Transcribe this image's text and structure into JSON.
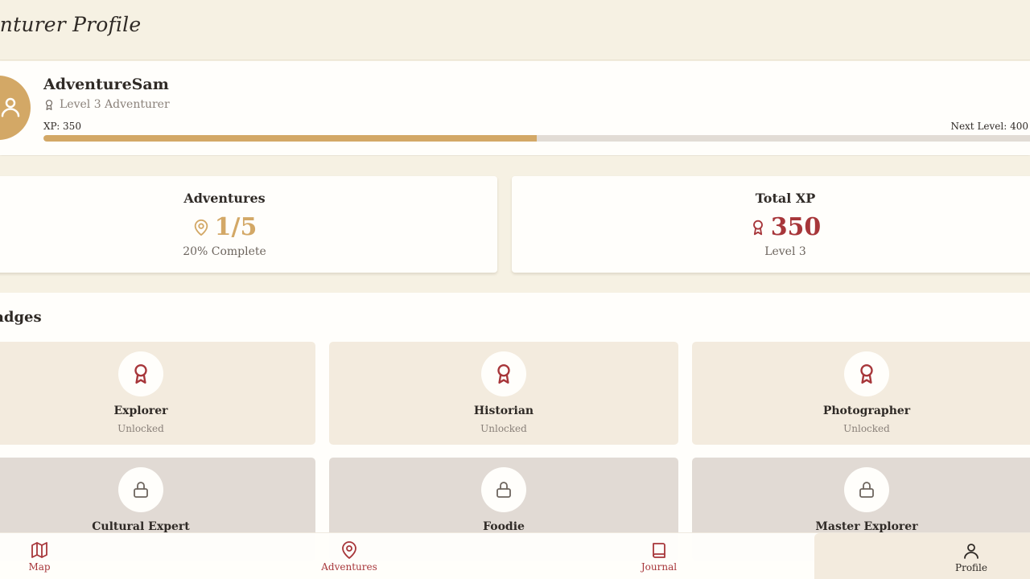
{
  "header": {
    "title": "Adventurer Profile"
  },
  "profile": {
    "username": "AdventureSam",
    "level_text": "Level 3 Adventurer",
    "xp_label": "XP: 350",
    "next_level_label": "Next Level: 400",
    "xp_progress_fraction": 0.5,
    "avatar_icon": "user-icon"
  },
  "stats": {
    "adventures": {
      "title": "Adventures",
      "value": "1/5",
      "subtitle": "20% Complete",
      "icon": "map-pin-icon"
    },
    "total_xp": {
      "title": "Total XP",
      "value": "350",
      "subtitle": "Level 3",
      "icon": "award-icon"
    }
  },
  "badges": {
    "heading": "Badges",
    "items": [
      {
        "name": "Explorer",
        "status": "Unlocked",
        "locked": false,
        "icon": "award-icon"
      },
      {
        "name": "Historian",
        "status": "Unlocked",
        "locked": false,
        "icon": "award-icon"
      },
      {
        "name": "Photographer",
        "status": "Unlocked",
        "locked": false,
        "icon": "award-icon"
      },
      {
        "name": "Cultural Expert",
        "status": "",
        "locked": true,
        "icon": "lock-icon"
      },
      {
        "name": "Foodie",
        "status": "",
        "locked": true,
        "icon": "lock-icon"
      },
      {
        "name": "Master Explorer",
        "status": "",
        "locked": true,
        "icon": "lock-icon"
      }
    ]
  },
  "nav": {
    "items": [
      {
        "label": "Map",
        "icon": "map-icon"
      },
      {
        "label": "Adventures",
        "icon": "map-pin-icon"
      },
      {
        "label": "Journal",
        "icon": "book-icon"
      },
      {
        "label": "Profile",
        "icon": "user-icon",
        "active": true
      }
    ]
  },
  "colors": {
    "accent_gold": "#d3a866",
    "accent_red": "#a7363a",
    "background": "#f6f1e3"
  }
}
